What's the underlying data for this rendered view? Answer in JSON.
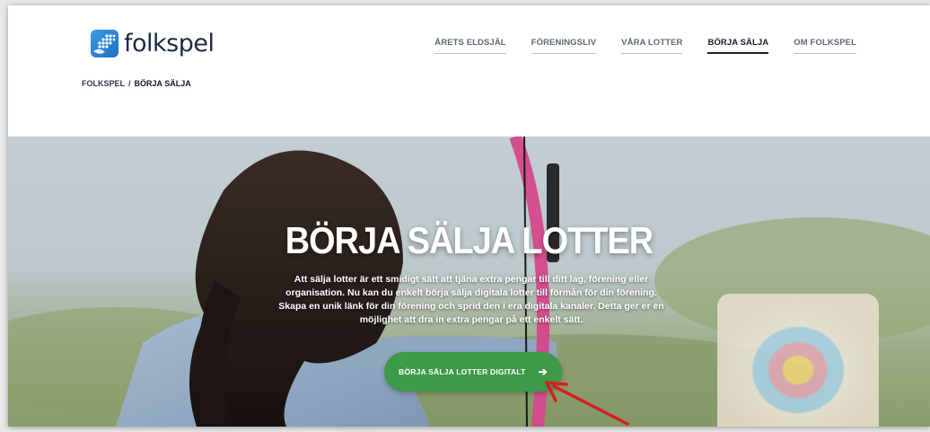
{
  "brand": {
    "name": "folkspel",
    "logo_icon": "folkspel-logo-icon"
  },
  "nav": {
    "items": [
      {
        "label": "ÅRETS ELDSJÄL",
        "active": false
      },
      {
        "label": "FÖRENINGSLIV",
        "active": false
      },
      {
        "label": "VÅRA LOTTER",
        "active": false
      },
      {
        "label": "BÖRJA SÄLJA",
        "active": true
      },
      {
        "label": "OM FOLKSPEL",
        "active": false
      }
    ]
  },
  "breadcrumb": {
    "root": "FOLKSPEL",
    "separator": "/",
    "current": "BÖRJA SÄLJA"
  },
  "hero": {
    "title": "BÖRJA SÄLJA LOTTER",
    "description": "Att sälja lotter är ett smidigt sätt att tjäna extra pengar till ditt lag, förening eller organisation. Nu kan du enkelt börja sälja digitala lotter till förmån för din förening. Skapa en unik länk för din förening och sprid den i era digitala kanaler. Detta ger er en möjlighet att dra in extra pengar på ett enkelt sätt.",
    "cta_label": "BÖRJA SÄLJA LOTTER DIGITALT",
    "cta_icon": "arrow-right-icon"
  },
  "colors": {
    "brand_blue": "#2f86d6",
    "cta_green": "#3e9a48",
    "nav_active": "#14202e",
    "annotation_red": "#d42020"
  }
}
